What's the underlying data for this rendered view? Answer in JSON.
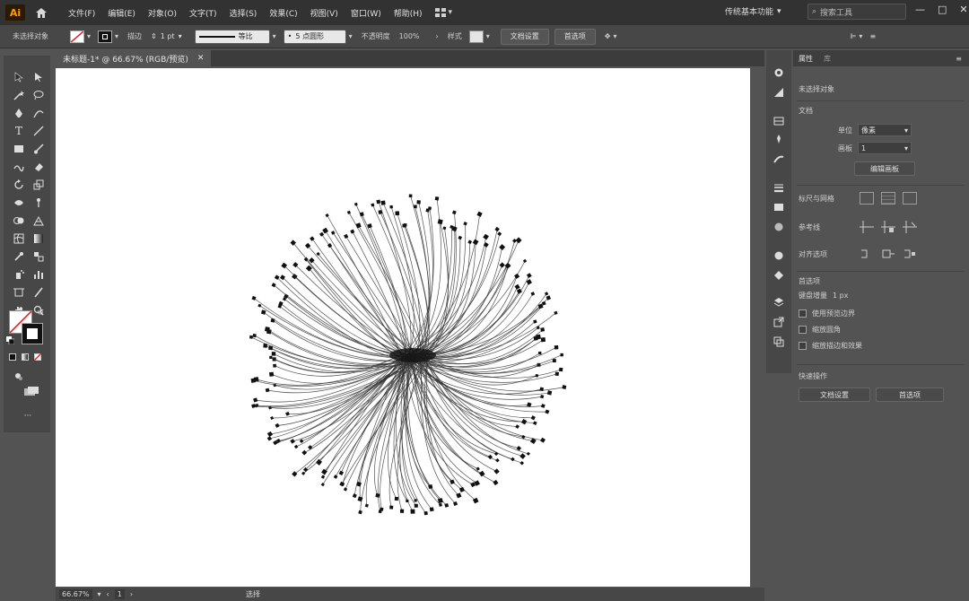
{
  "menubar": {
    "logo": "Ai",
    "items": [
      "文件(F)",
      "编辑(E)",
      "对象(O)",
      "文字(T)",
      "选择(S)",
      "效果(C)",
      "视图(V)",
      "窗口(W)",
      "帮助(H)"
    ],
    "workspace": "传统基本功能",
    "search_placeholder": "搜索工具",
    "window_controls": [
      "—",
      "□",
      "✕"
    ]
  },
  "controlbar": {
    "selection": "未选择对象",
    "stroke_label": "描边",
    "stroke_value": "1 pt",
    "stroke_style": "等比",
    "brush": "5 点圆形",
    "opacity_label": "不透明度",
    "opacity_value": "100%",
    "style_label": "样式",
    "doc_setup": "文档设置",
    "preferences": "首选项"
  },
  "document": {
    "tab_title": "未标题-1* @ 66.67% (RGB/预览)",
    "close": "✕"
  },
  "statusbar": {
    "zoom": "66.67%",
    "artboard": "1",
    "tool": "选择"
  },
  "properties": {
    "tabs": [
      "属性",
      "库"
    ],
    "no_selection": "未选择对象",
    "document_title": "文档",
    "units_label": "单位",
    "units_value": "像素",
    "artboard_label": "画板",
    "artboard_value": "1",
    "edit_artboards": "编辑画板",
    "rulers_grids": "标尺与网格",
    "guides": "参考线",
    "snap": "对齐选项",
    "preferences_title": "首选项",
    "keyboard_increment_label": "键盘增量",
    "keyboard_increment_value": "1 px",
    "cb_preview_bounds": "使用预览边界",
    "cb_scale_corners": "缩放圆角",
    "cb_scale_strokes": "缩放描边和效果",
    "quick_actions": "快速操作",
    "btn_doc_setup": "文档设置",
    "btn_prefs": "首选项"
  },
  "colors": {
    "ui_dark": "#323232",
    "ui_mid": "#474747",
    "ui_bg": "#535353",
    "artboard": "#ffffff",
    "lines": "#333333"
  }
}
